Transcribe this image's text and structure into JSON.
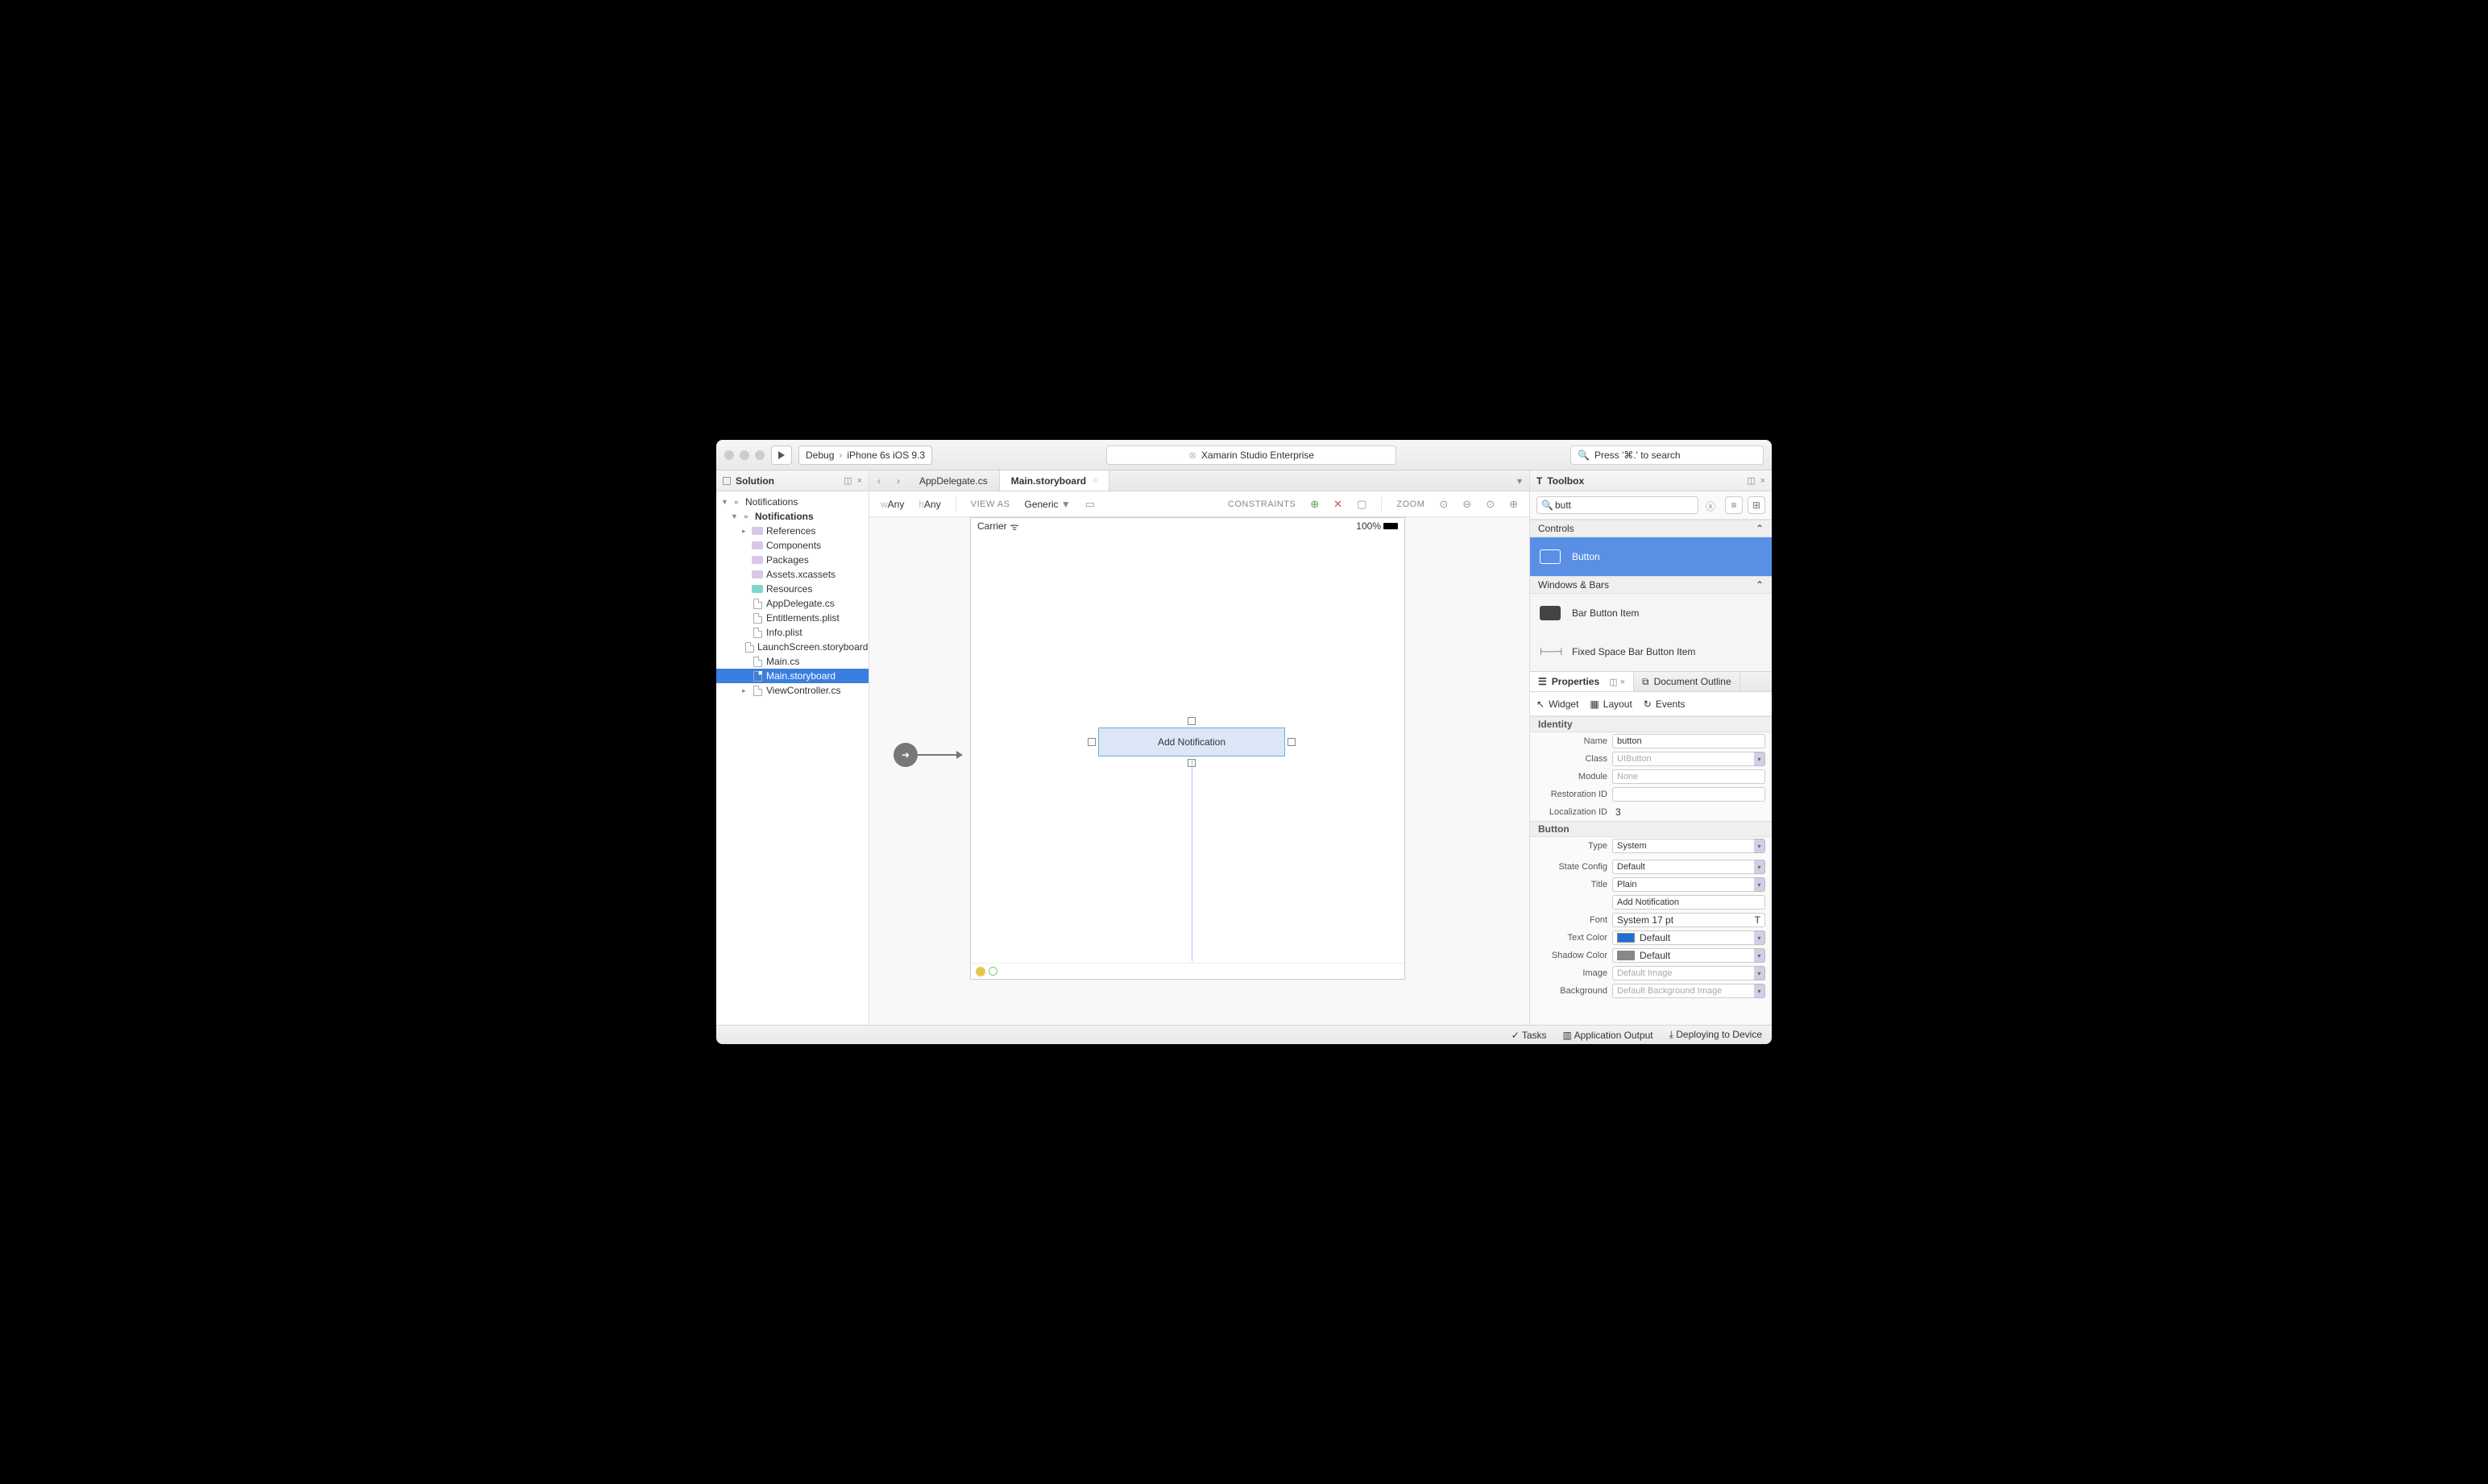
{
  "titlebar": {
    "config": "Debug",
    "device": "iPhone 6s iOS 9.3",
    "app_title": "Xamarin Studio Enterprise",
    "search_placeholder": "Press '⌘.' to search"
  },
  "solution": {
    "header": "Solution",
    "root": "Notifications",
    "project": "Notifications",
    "items": [
      {
        "label": "References",
        "kind": "folder",
        "exp": true
      },
      {
        "label": "Components",
        "kind": "folder"
      },
      {
        "label": "Packages",
        "kind": "folder"
      },
      {
        "label": "Assets.xcassets",
        "kind": "folder"
      },
      {
        "label": "Resources",
        "kind": "folder-teal"
      },
      {
        "label": "AppDelegate.cs",
        "kind": "file"
      },
      {
        "label": "Entitlements.plist",
        "kind": "file"
      },
      {
        "label": "Info.plist",
        "kind": "file"
      },
      {
        "label": "LaunchScreen.storyboard",
        "kind": "file"
      },
      {
        "label": "Main.cs",
        "kind": "file"
      },
      {
        "label": "Main.storyboard",
        "kind": "file",
        "sel": true
      },
      {
        "label": "ViewController.cs",
        "kind": "file",
        "exp": true
      }
    ]
  },
  "editor": {
    "tabs": [
      {
        "label": "AppDelegate.cs",
        "active": false
      },
      {
        "label": "Main.storyboard",
        "active": true
      }
    ],
    "size_w": "wAny",
    "size_h": "hAny",
    "view_as_label": "VIEW AS",
    "view_as": "Generic",
    "constraints_label": "CONSTRAINTS",
    "zoom_label": "ZOOM",
    "device": {
      "carrier": "Carrier",
      "battery": "100%"
    },
    "button_text": "Add Notification"
  },
  "toolbox": {
    "header": "Toolbox",
    "filter": "butt",
    "cat1": "Controls",
    "item1": "Button",
    "cat2": "Windows & Bars",
    "item2": "Bar Button Item",
    "item3": "Fixed Space Bar Button Item"
  },
  "props": {
    "tab_properties": "Properties",
    "tab_outline": "Document Outline",
    "sub_widget": "Widget",
    "sub_layout": "Layout",
    "sub_events": "Events",
    "sec_identity": "Identity",
    "name_lbl": "Name",
    "name_val": "button",
    "class_lbl": "Class",
    "class_ph": "UIButton",
    "module_lbl": "Module",
    "module_ph": "None",
    "restid_lbl": "Restoration ID",
    "locid_lbl": "Localization ID",
    "locid_val": "3",
    "sec_button": "Button",
    "type_lbl": "Type",
    "type_val": "System",
    "state_lbl": "State Config",
    "state_val": "Default",
    "title_lbl": "Title",
    "title_val": "Plain",
    "title_text": "Add Notification",
    "font_lbl": "Font",
    "font_val": "System 17 pt",
    "tcolor_lbl": "Text Color",
    "tcolor_val": "Default",
    "scolor_lbl": "Shadow Color",
    "scolor_val": "Default",
    "image_lbl": "Image",
    "image_ph": "Default Image",
    "bg_lbl": "Background",
    "bg_ph": "Default Background Image"
  },
  "status": {
    "tasks": "Tasks",
    "output": "Application Output",
    "deploy": "Deploying to Device"
  }
}
